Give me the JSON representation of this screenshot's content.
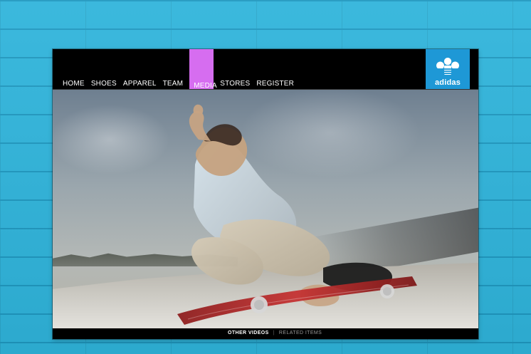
{
  "nav": {
    "items": [
      {
        "label": "HOME"
      },
      {
        "label": "SHOES"
      },
      {
        "label": "APPAREL"
      },
      {
        "label": "TEAM"
      },
      {
        "label": "MEDIA"
      },
      {
        "label": "STORES"
      },
      {
        "label": "REGISTER"
      }
    ],
    "active": "MEDIA"
  },
  "brand": {
    "name": "adidas",
    "logo_icon": "trefoil-icon",
    "logo_bg": "#1e98d6"
  },
  "footer": {
    "links": [
      {
        "label": "OTHER VIDEOS"
      },
      {
        "label": "RELATED ITEMS"
      }
    ],
    "separator": "|"
  },
  "colors": {
    "page_bg": "#2fb4db",
    "active_tab": "#d66df0"
  }
}
